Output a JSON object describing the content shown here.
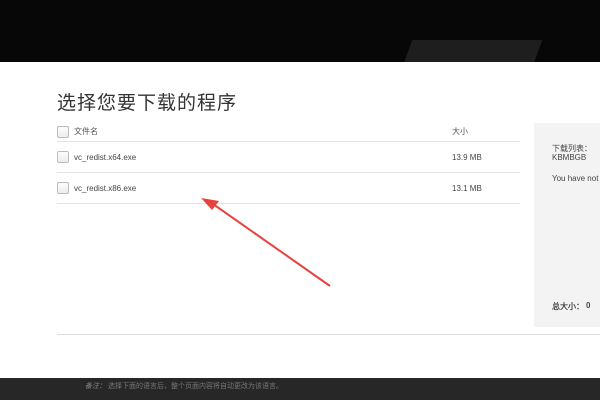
{
  "dialog": {
    "title": "选择您要下载的程序"
  },
  "table": {
    "col_name": "文件名",
    "col_size": "大小",
    "rows": [
      {
        "name": "vc_redist.x64.exe",
        "size": "13.9 MB"
      },
      {
        "name": "vc_redist.x86.exe",
        "size": "13.1 MB"
      }
    ]
  },
  "side_panel": {
    "list_label": "下载列表：",
    "list_unit": "KBMBGB",
    "empty_text": "You have not",
    "total_label": "总大小：",
    "total_value": "0"
  },
  "footer": {
    "note_label": "备注：",
    "note_text": "选择下面的语言后，整个页面内容将自动更改为该语言。"
  },
  "colors": {
    "annotation_arrow": "#e8423f",
    "top_band": "#070707",
    "footer": "#272727"
  }
}
